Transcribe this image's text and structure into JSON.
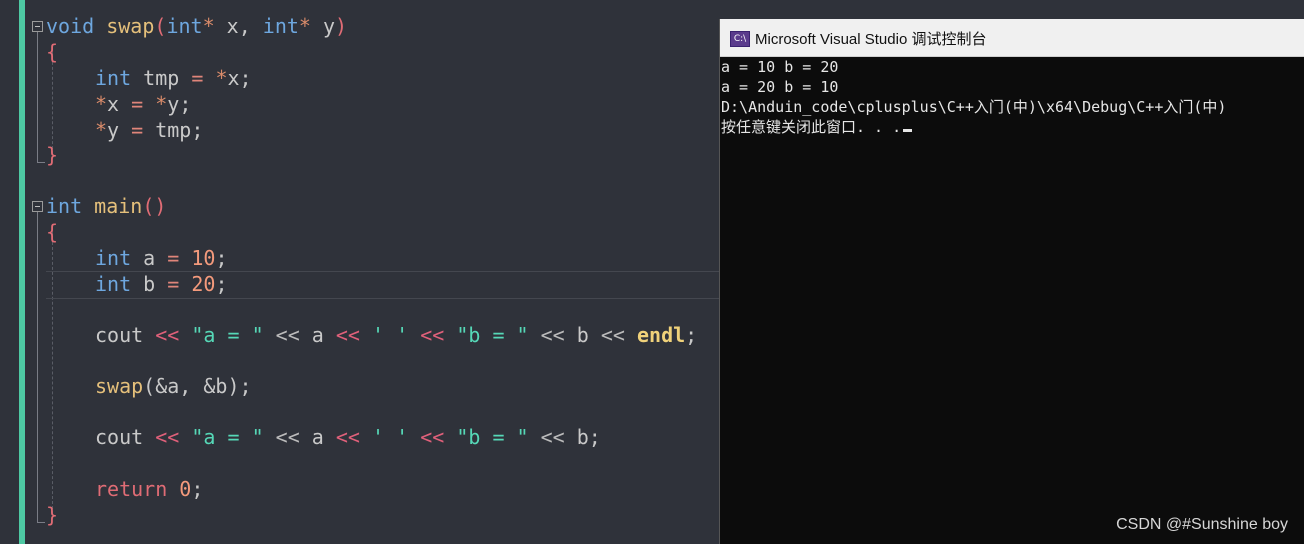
{
  "editor": {
    "lines": {
      "l1": [
        "void",
        " ",
        "swap",
        "(",
        "int",
        "*",
        " x, ",
        "int",
        "*",
        " y",
        ")"
      ],
      "l2": "{",
      "l3": [
        "int",
        " tmp ",
        "=",
        " ",
        "*",
        "x;"
      ],
      "l4": [
        "*",
        "x ",
        "=",
        " ",
        "*",
        "y;"
      ],
      "l5": [
        "*",
        "y ",
        "=",
        " tmp;"
      ],
      "l6": "}",
      "l8": [
        "int",
        " ",
        "main",
        "()"
      ],
      "l9": "{",
      "l10": [
        "int",
        " a ",
        "=",
        " ",
        "10",
        ";"
      ],
      "l11": [
        "int",
        " b ",
        "=",
        " ",
        "20",
        ";"
      ],
      "l13": [
        "cout",
        " ",
        "<<",
        " ",
        "\"a = \"",
        " ",
        "<<",
        " a ",
        "<<",
        " ",
        "' '",
        " ",
        "<<",
        " ",
        "\"b = \"",
        " ",
        "<<",
        " b ",
        "<<",
        " ",
        "endl",
        ";"
      ],
      "l15": [
        "swap",
        "(&a, &b);"
      ],
      "l17": [
        "cout",
        " ",
        "<<",
        " ",
        "\"a = \"",
        " ",
        "<<",
        " a ",
        "<<",
        " ",
        "' '",
        " ",
        "<<",
        " ",
        "\"b = \"",
        " ",
        "<<",
        " b;"
      ],
      "l19": [
        "return",
        " ",
        "0",
        ";"
      ],
      "l20": "}"
    }
  },
  "console": {
    "title": "Microsoft Visual Studio 调试控制台",
    "icon_label": "C:\\",
    "output": [
      "a = 10 b = 20",
      "a = 20 b = 10",
      "D:\\Anduin_code\\cplusplus\\C++入门(中)\\x64\\Debug\\C++入门(中)",
      "按任意键关闭此窗口. . ."
    ]
  },
  "watermark": "CSDN @#Sunshine boy"
}
